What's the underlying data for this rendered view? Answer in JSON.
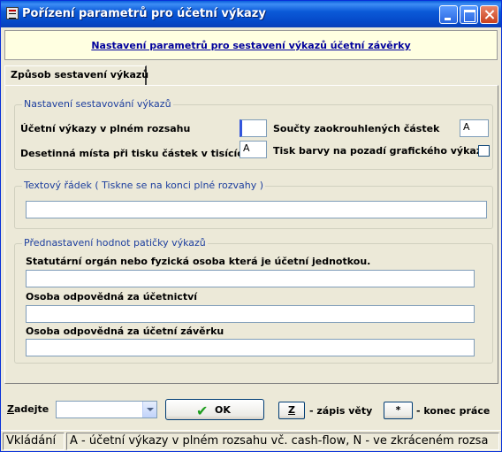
{
  "window": {
    "title": "Pořízení parametrů pro účetní výkazy"
  },
  "banner": {
    "text": "Nastavení parametrů pro sestavení výkazů účetní závěrky"
  },
  "tabs": [
    {
      "label": "Způsob sestavení výkazů"
    }
  ],
  "group_settings": {
    "title": "Nastavení sestavování výkazů",
    "full_reports_label": "Účetní výkazy v plném rozsahu",
    "full_reports_value": "",
    "decimals_label": "Desetinná místa při tisku částek v tisících",
    "decimals_value": "A",
    "rounded_sums_label": "Součty zaokrouhlených částek",
    "rounded_sums_value": "A",
    "bg_color_label": "Tisk barvy na pozadí grafického výkazu"
  },
  "group_text_row": {
    "title": "Textový řádek ( Tiskne se na konci plné rozvahy )",
    "value": ""
  },
  "group_footer": {
    "title": "Přednastavení hodnot patičky výkazů",
    "statutory_label": "Statutární orgán nebo fyzická osoba která je účetní jednotkou.",
    "statutory_value": "",
    "accounting_label": "Osoba odpovědná za účetnictví",
    "accounting_value": "",
    "closing_label": "Osoba odpovědná za účetní závěrku",
    "closing_value": ""
  },
  "bottom": {
    "enter_label_prefix": "Z",
    "enter_label_rest": "adejte",
    "combo_value": "",
    "ok_label": "OK",
    "key_z": "Z",
    "key_z_desc": "- zápis věty",
    "key_star": "*",
    "key_star_desc": "- konec práce"
  },
  "status": {
    "mode": "Vkládání",
    "hint": "A - účetní výkazy v plném rozsahu vč. cash-flow, N - ve zkráceném rozsa"
  },
  "colors": {
    "title_bar": "#0548C8",
    "banner_bg": "#FFFFE1",
    "banner_link": "#00009C",
    "group_title": "#1C3E9E",
    "dialog_bg": "#ECE9D8"
  }
}
